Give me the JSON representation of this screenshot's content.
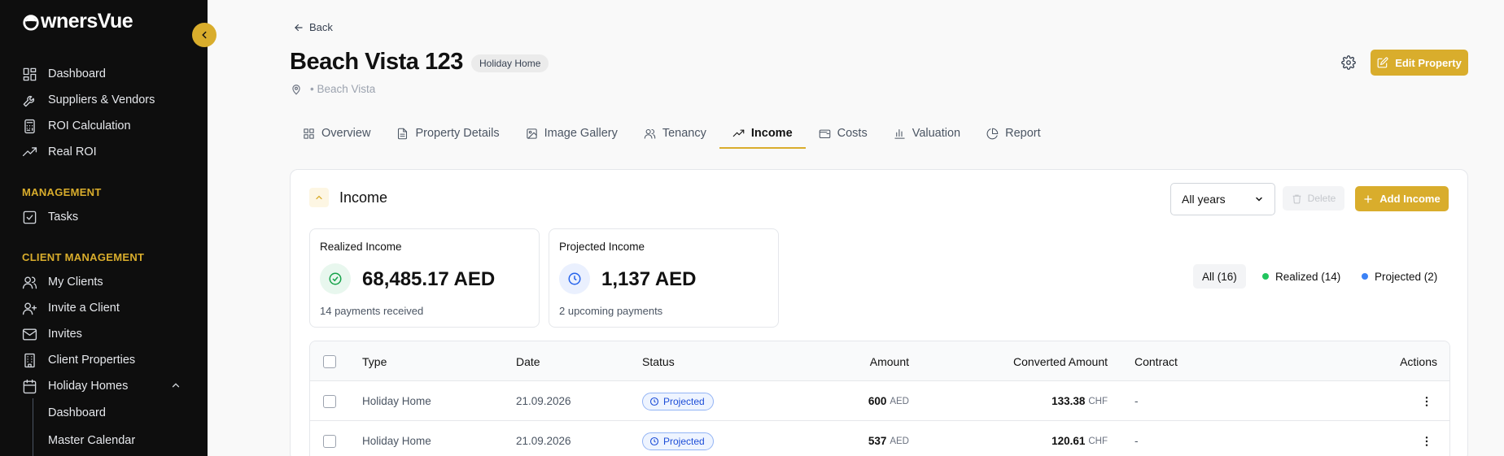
{
  "sidebar": {
    "logo_text": "wnersVue",
    "nav_top": [
      {
        "label": "Dashboard",
        "icon": "dashboard-icon"
      },
      {
        "label": "Suppliers & Vendors",
        "icon": "wrench-icon"
      },
      {
        "label": "ROI Calculation",
        "icon": "calculator-icon"
      },
      {
        "label": "Real ROI",
        "icon": "trending-up-icon"
      }
    ],
    "management_title": "MANAGEMENT",
    "management_items": [
      {
        "label": "Tasks",
        "icon": "checkbox-icon"
      }
    ],
    "client_title": "CLIENT MANAGEMENT",
    "client_items": [
      {
        "label": "My Clients",
        "icon": "users-icon"
      },
      {
        "label": "Invite a Client",
        "icon": "user-plus-icon"
      },
      {
        "label": "Invites",
        "icon": "mail-icon"
      },
      {
        "label": "Client Properties",
        "icon": "building-icon"
      },
      {
        "label": "Holiday Homes",
        "icon": "calendar-icon"
      }
    ],
    "holiday_sub_items": [
      "Dashboard",
      "Master Calendar"
    ]
  },
  "header": {
    "back_label": "Back",
    "title": "Beach Vista 123",
    "badge": "Holiday Home",
    "location": "• Beach Vista",
    "edit_label": "Edit Property"
  },
  "tabs": [
    {
      "label": "Overview",
      "icon": "grid-icon"
    },
    {
      "label": "Property Details",
      "icon": "file-icon"
    },
    {
      "label": "Image Gallery",
      "icon": "image-icon"
    },
    {
      "label": "Tenancy",
      "icon": "users-icon"
    },
    {
      "label": "Income",
      "icon": "trending-up-icon",
      "active": true
    },
    {
      "label": "Costs",
      "icon": "wallet-icon"
    },
    {
      "label": "Valuation",
      "icon": "bar-chart-icon"
    },
    {
      "label": "Report",
      "icon": "pie-chart-icon"
    }
  ],
  "income": {
    "title": "Income",
    "year_select": "All years",
    "delete_label": "Delete",
    "add_label": "Add Income",
    "realized": {
      "label": "Realized Income",
      "value": "68,485.17 AED",
      "sub": "14 payments received",
      "color": "#16a34a"
    },
    "projected": {
      "label": "Projected Income",
      "value": "1,137 AED",
      "sub": "2 upcoming payments",
      "color": "#2563eb"
    },
    "filters": {
      "all": "All (16)",
      "realized": "Realized (14)",
      "projected": "Projected (2)"
    },
    "columns": [
      "Type",
      "Date",
      "Status",
      "Amount",
      "Converted Amount",
      "Contract",
      "Actions"
    ],
    "rows": [
      {
        "type": "Holiday Home",
        "date": "21.09.2026",
        "status": "Projected",
        "amount": "600",
        "amount_cur": "AED",
        "converted": "133.38",
        "converted_cur": "CHF",
        "contract": "-"
      },
      {
        "type": "Holiday Home",
        "date": "21.09.2026",
        "status": "Projected",
        "amount": "537",
        "amount_cur": "AED",
        "converted": "120.61",
        "converted_cur": "CHF",
        "contract": "-"
      }
    ]
  },
  "colors": {
    "accent": "#d9ad2c",
    "sidebar_bg": "#0e0e0e",
    "projected_blue": "#1d4ed8",
    "realized_green": "#16a34a"
  }
}
